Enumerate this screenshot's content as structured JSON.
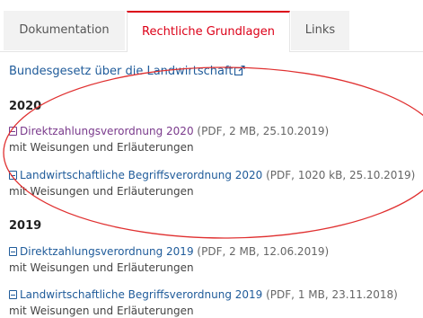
{
  "tabs": [
    {
      "label": "Dokumentation",
      "active": false
    },
    {
      "label": "Rechtliche Grundlagen",
      "active": true
    },
    {
      "label": "Links",
      "active": false
    }
  ],
  "main_link": {
    "label": "Bundesgesetz über die Landwirtschaft",
    "icon": "external-link-icon"
  },
  "sections": [
    {
      "year": "2020",
      "documents": [
        {
          "title": "Direktzahlungsverordnung 2020",
          "meta": "(PDF, 2 MB, 25.10.2019)",
          "subtitle": "mit Weisungen und Erläuterungen",
          "icon": "pdf-icon"
        },
        {
          "title": "Landwirtschaftliche Begriffsverordnung 2020",
          "meta": "(PDF, 1020 kB, 25.10.2019)",
          "subtitle": "mit Weisungen und Erläuterungen",
          "icon": "pdf-icon"
        }
      ]
    },
    {
      "year": "2019",
      "documents": [
        {
          "title": "Direktzahlungsverordnung 2019",
          "meta": "(PDF, 2 MB, 12.06.2019)",
          "subtitle": "mit Weisungen und Erläuterungen",
          "icon": "pdf-icon"
        },
        {
          "title": "Landwirtschaftliche Begriffsverordnung 2019",
          "meta": "(PDF, 1 MB, 23.11.2018)",
          "subtitle": "mit Weisungen und Erläuterungen",
          "icon": "pdf-icon"
        }
      ]
    }
  ],
  "colors": {
    "accent": "#dc0018",
    "link": "#1f5b9a",
    "visited_link": "#7a3a8c",
    "annotation": "#e03030"
  }
}
